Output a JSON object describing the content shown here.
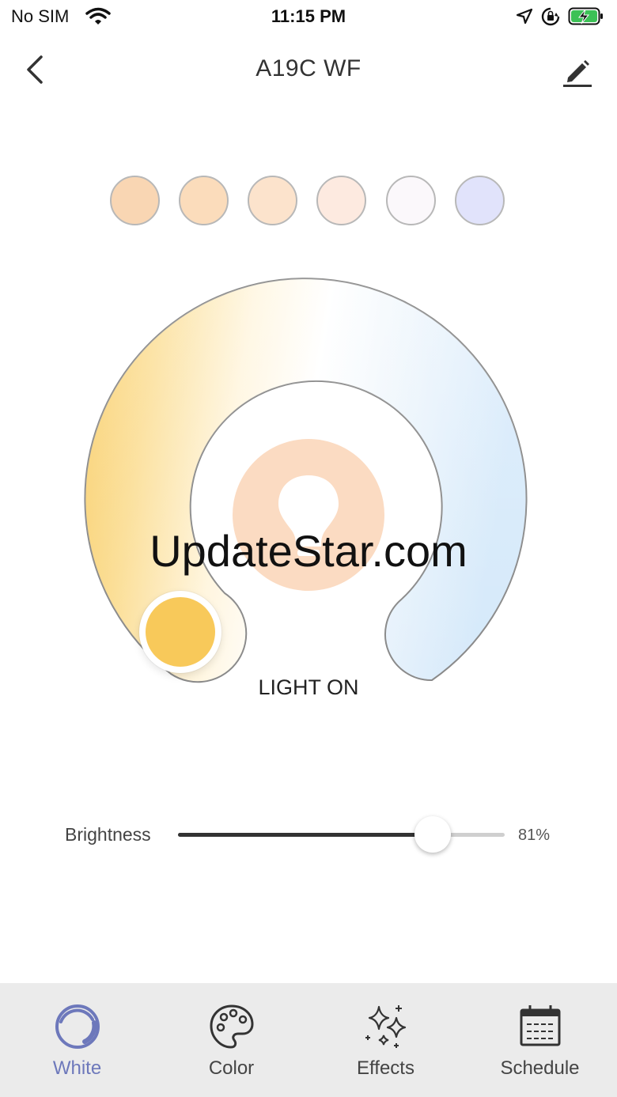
{
  "status_bar": {
    "carrier": "No SIM",
    "time": "11:15 PM",
    "icons": [
      "wifi-icon",
      "location-arrow-icon",
      "rotation-lock-icon",
      "battery-charging-icon"
    ]
  },
  "header": {
    "title": "A19C WF",
    "back_icon": "chevron-left-icon",
    "edit_icon": "pencil-icon"
  },
  "presets": [
    {
      "name": "preset-1",
      "color": "#f9d6b3"
    },
    {
      "name": "preset-2",
      "color": "#fbdcbb"
    },
    {
      "name": "preset-3",
      "color": "#fce3cc"
    },
    {
      "name": "preset-4",
      "color": "#fdeae0"
    },
    {
      "name": "preset-5",
      "color": "#fbf8fb"
    },
    {
      "name": "preset-6",
      "color": "#e1e3fb"
    }
  ],
  "ring": {
    "warm_color": "#f8c95a",
    "cool_color": "#d7ebfb",
    "center_color": "#fbdbc2",
    "status_text": "LIGHT ON"
  },
  "brightness": {
    "label": "Brightness",
    "value_text": "81%",
    "value": 0.78,
    "fill_color": "#333333",
    "track_color": "#cfcfcf"
  },
  "watermark": "UpdateStar.com",
  "tabs": [
    {
      "label": "White",
      "icon": "white-ring-icon",
      "active": true
    },
    {
      "label": "Color",
      "icon": "palette-icon",
      "active": false
    },
    {
      "label": "Effects",
      "icon": "sparkles-icon",
      "active": false
    },
    {
      "label": "Schedule",
      "icon": "calendar-icon",
      "active": false
    }
  ],
  "accent_color": "#6d78bb"
}
